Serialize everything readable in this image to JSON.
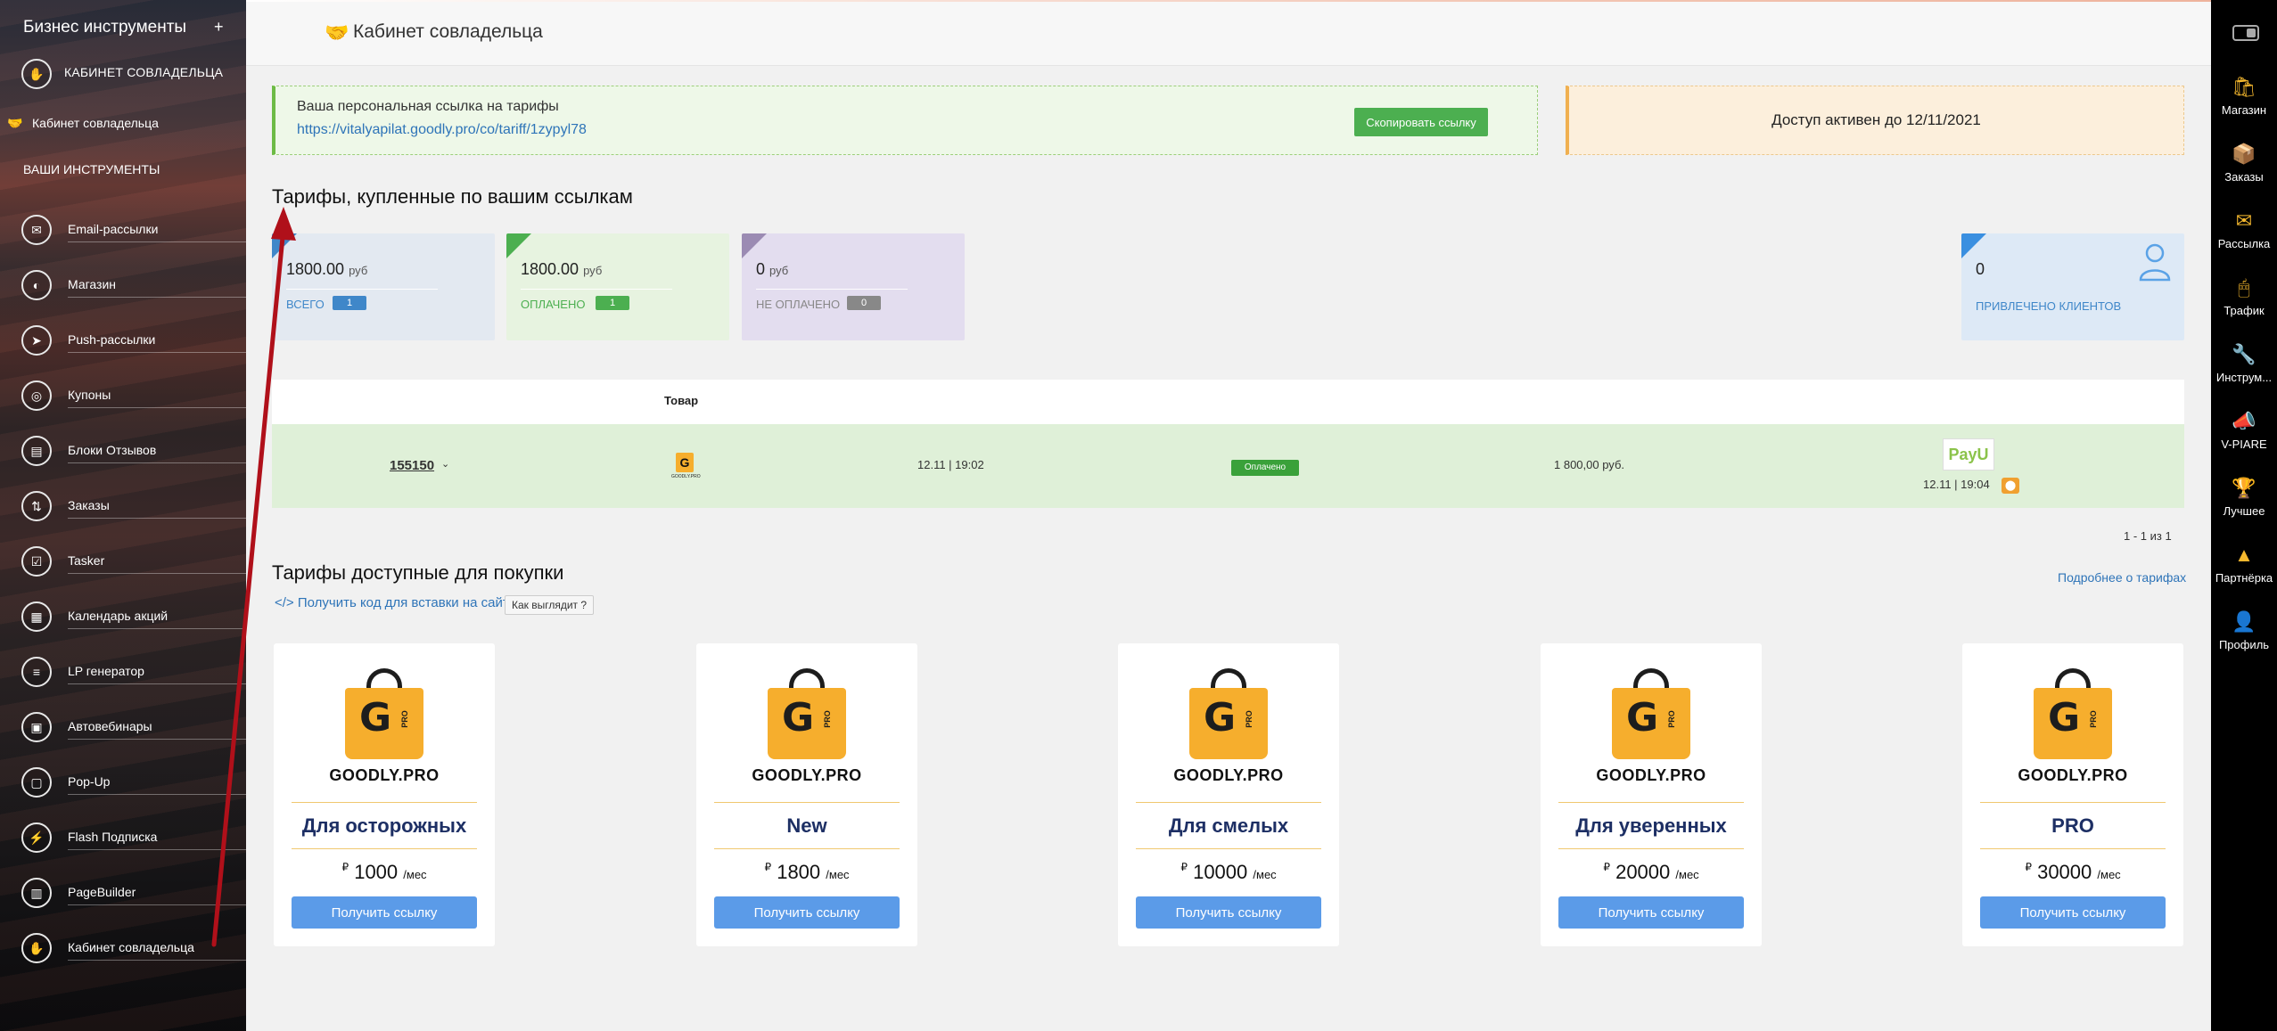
{
  "sidebar": {
    "brand": "Бизнес инструменты",
    "plus": "+",
    "head_label": "КАБИНЕТ СОВЛАДЕЛЬЦА",
    "active_item": "Кабинет совладельца",
    "section_title": "ВАШИ ИНСТРУМЕНТЫ",
    "items": [
      {
        "label": "Email-рассылки",
        "icon": "envelope-icon"
      },
      {
        "label": "Магазин",
        "icon": "bag-icon"
      },
      {
        "label": "Push-рассылки",
        "icon": "paper-plane-icon"
      },
      {
        "label": "Купоны",
        "icon": "coupon-icon"
      },
      {
        "label": "Блоки Отзывов",
        "icon": "reviews-icon"
      },
      {
        "label": "Заказы",
        "icon": "orders-icon"
      },
      {
        "label": "Tasker",
        "icon": "checkbox-icon"
      },
      {
        "label": "Календарь акций",
        "icon": "calendar-icon"
      },
      {
        "label": "LP генератор",
        "icon": "lp-icon"
      },
      {
        "label": "Автовебинары",
        "icon": "webinar-icon"
      },
      {
        "label": "Pop-Up",
        "icon": "popup-icon"
      },
      {
        "label": "Flash Подписка",
        "icon": "flash-icon"
      },
      {
        "label": "PageBuilder",
        "icon": "pagebuilder-icon"
      },
      {
        "label": "Кабинет совладельца",
        "icon": "handshake-icon"
      }
    ]
  },
  "rail": {
    "items": [
      {
        "label": "Магазин",
        "icon": "shop-bag-icon"
      },
      {
        "label": "Заказы",
        "icon": "orders-icon"
      },
      {
        "label": "Рассылка",
        "icon": "mail-icon"
      },
      {
        "label": "Трафик",
        "icon": "mouse-icon"
      },
      {
        "label": "Инструм...",
        "icon": "tools-icon"
      },
      {
        "label": "V-PIARE",
        "icon": "megaphone-icon"
      },
      {
        "label": "Лучшее",
        "icon": "best-icon"
      },
      {
        "label": "Партнёрка",
        "icon": "pyramid-icon"
      },
      {
        "label": "Профиль",
        "icon": "profile-icon"
      }
    ]
  },
  "header": {
    "title": "Кабинет совладельца"
  },
  "link_card": {
    "label": "Ваша персональная ссылка на тарифы",
    "url": "https://vitalyapilat.goodly.pro/co/tariff/1zypyl78",
    "copy_button": "Скопировать ссылку"
  },
  "access": {
    "text": "Доступ активен до 12/11/2021"
  },
  "purchased": {
    "title": "Тарифы, купленные по вашим ссылкам",
    "stats": [
      {
        "amount": "1800.00",
        "unit": "руб",
        "label": "ВСЕГО",
        "count": "1",
        "color": "#3f87c9"
      },
      {
        "amount": "1800.00",
        "unit": "руб",
        "label": "ОПЛАЧЕНО",
        "count": "1",
        "color": "#4caf50"
      },
      {
        "amount": "0",
        "unit": "руб",
        "label": "НЕ ОПЛАЧЕНО",
        "count": "0",
        "color": "#888888"
      }
    ],
    "clients": {
      "count": "0",
      "label": "ПРИВЛЕЧЕНО КЛИЕНТОВ"
    }
  },
  "orders_table": {
    "header": "Товар",
    "row": {
      "id": "155150",
      "product_logo": "GOODLY.PRO",
      "date": "12.11 | 19:02",
      "status": "Оплачено",
      "amount": "1 800,00 руб.",
      "payment_system": "PayU",
      "paid_at": "12.11 | 19:04"
    },
    "pager": "1 - 1 из 1"
  },
  "available": {
    "title": "Тарифы доступные для покупки",
    "code_link": "</> Получить код для вставки на сайт",
    "look_button": "Как выглядит ?",
    "more_link": "Подробнее о тарифах",
    "tariffs": [
      {
        "brand": "GOODLY.PRO",
        "name": "Для осторожных",
        "price": "1000",
        "currency": "₽",
        "period": "/мес",
        "button": "Получить ссылку"
      },
      {
        "brand": "GOODLY.PRO",
        "name": "New",
        "price": "1800",
        "currency": "₽",
        "period": "/мес",
        "button": "Получить ссылку"
      },
      {
        "brand": "GOODLY.PRO",
        "name": "Для смелых",
        "price": "10000",
        "currency": "₽",
        "period": "/мес",
        "button": "Получить ссылку"
      },
      {
        "brand": "GOODLY.PRO",
        "name": "Для уверенных",
        "price": "20000",
        "currency": "₽",
        "period": "/мес",
        "button": "Получить ссылку"
      },
      {
        "brand": "GOODLY.PRO",
        "name": "PRO",
        "price": "30000",
        "currency": "₽",
        "period": "/мес",
        "button": "Получить ссылку"
      }
    ]
  },
  "colors": {
    "accent_green": "#4caf50",
    "link_blue": "#2e74b8",
    "button_blue": "#5b9be8",
    "arrow_red": "#b0101a",
    "bag_orange": "#f6ae2d"
  }
}
